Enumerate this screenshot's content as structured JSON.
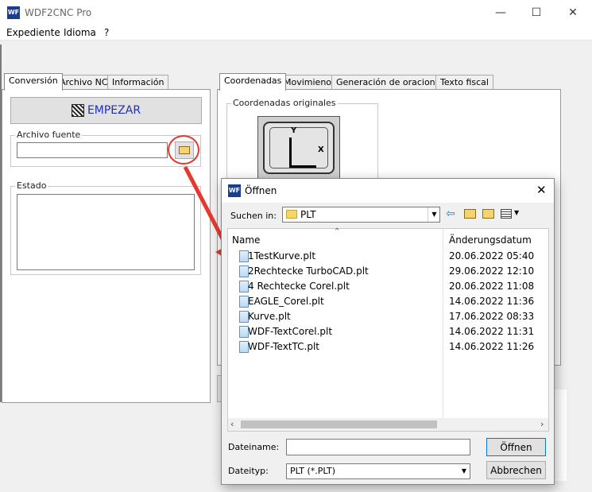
{
  "app": {
    "title": "WDF2CNC Pro",
    "icon_text": "WF"
  },
  "window_controls": {
    "minimize": "—",
    "maximize": "☐",
    "close": "✕"
  },
  "menu": [
    "Expediente",
    "Idioma",
    "?"
  ],
  "left_tabs": [
    "Conversión",
    "Archivo NC",
    "Información"
  ],
  "start_button": "EMPEZAR",
  "source_file_label": "Archivo fuente",
  "status_label": "Estado",
  "right_tabs": [
    "Coordenadas",
    "Movimienot",
    "Generación de oraciones",
    "Texto fiscal"
  ],
  "coords_group_label": "Coordenadas originales",
  "axis_labels": {
    "y": "Y",
    "x": "X"
  },
  "dialog": {
    "title": "Öffnen",
    "look_in_label": "Suchen in:",
    "look_in_value": "PLT",
    "col_name": "Name",
    "col_date": "Änderungsdatum",
    "files": [
      {
        "name": "1TestKurve.plt",
        "date": "20.06.2022 05:40"
      },
      {
        "name": "2Rechtecke TurboCAD.plt",
        "date": "29.06.2022 12:10"
      },
      {
        "name": "4 Rechtecke Corel.plt",
        "date": "20.06.2022 11:08"
      },
      {
        "name": "EAGLE_Corel.plt",
        "date": "14.06.2022 11:36"
      },
      {
        "name": "Kurve.plt",
        "date": "17.06.2022 08:33"
      },
      {
        "name": "WDF-TextCorel.plt",
        "date": "14.06.2022 11:31"
      },
      {
        "name": "WDF-TextTC.plt",
        "date": "14.06.2022 11:26"
      }
    ],
    "filename_label": "Dateiname:",
    "filename_value": "",
    "filetype_label": "Dateityp:",
    "filetype_value": "PLT (*.PLT)",
    "open_button": "Öffnen",
    "cancel_button": "Abbrechen"
  },
  "colors": {
    "annotation": "#e8372e",
    "start_text": "#1f2fbf",
    "app_icon": "#1a3d8f"
  }
}
